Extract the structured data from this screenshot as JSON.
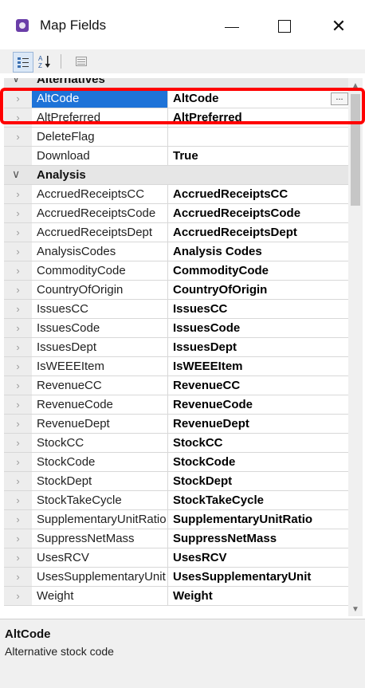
{
  "window": {
    "title": "Map Fields",
    "icon": "app-icon",
    "controls": [
      "minimize-icon",
      "maximize-icon",
      "close-icon"
    ]
  },
  "toolbar": {
    "buttons": [
      "categorized-icon",
      "alphabetical-sort-icon",
      "property-pages-icon"
    ]
  },
  "grid": {
    "partial_category": "Alternatives",
    "alternatives_rows": [
      {
        "name": "AltCode",
        "value": "AltCode",
        "selected": true
      },
      {
        "name": "AltPreferred",
        "value": "AltPreferred"
      },
      {
        "name": "DeleteFlag",
        "value": ""
      },
      {
        "name": "Download",
        "value": "True"
      }
    ],
    "analysis_category": "Analysis",
    "analysis_rows": [
      {
        "name": "AccruedReceiptsCC",
        "value": "AccruedReceiptsCC"
      },
      {
        "name": "AccruedReceiptsCode",
        "value": "AccruedReceiptsCode"
      },
      {
        "name": "AccruedReceiptsDept",
        "value": "AccruedReceiptsDept"
      },
      {
        "name": "AnalysisCodes",
        "value": "Analysis Codes"
      },
      {
        "name": "CommodityCode",
        "value": "CommodityCode"
      },
      {
        "name": "CountryOfOrigin",
        "value": "CountryOfOrigin"
      },
      {
        "name": "IssuesCC",
        "value": "IssuesCC"
      },
      {
        "name": "IssuesCode",
        "value": "IssuesCode"
      },
      {
        "name": "IssuesDept",
        "value": "IssuesDept"
      },
      {
        "name": "IsWEEEItem",
        "value": "IsWEEEItem"
      },
      {
        "name": "RevenueCC",
        "value": "RevenueCC"
      },
      {
        "name": "RevenueCode",
        "value": "RevenueCode"
      },
      {
        "name": "RevenueDept",
        "value": "RevenueDept"
      },
      {
        "name": "StockCC",
        "value": "StockCC"
      },
      {
        "name": "StockCode",
        "value": "StockCode"
      },
      {
        "name": "StockDept",
        "value": "StockDept"
      },
      {
        "name": "StockTakeCycle",
        "value": "StockTakeCycle"
      },
      {
        "name": "SupplementaryUnitRatio",
        "value": "SupplementaryUnitRatio"
      },
      {
        "name": "SuppressNetMass",
        "value": "SuppressNetMass"
      },
      {
        "name": "UsesRCV",
        "value": "UsesRCV"
      },
      {
        "name": "UsesSupplementaryUnit",
        "value": "UsesSupplementaryUnit"
      },
      {
        "name": "Weight",
        "value": "Weight"
      }
    ],
    "ellipsis_label": "..."
  },
  "description": {
    "title": "AltCode",
    "text": "Alternative stock code"
  },
  "colors": {
    "selection": "#1e73d8",
    "highlight_border": "#ff0000",
    "app_icon": "#6a3ea8"
  }
}
